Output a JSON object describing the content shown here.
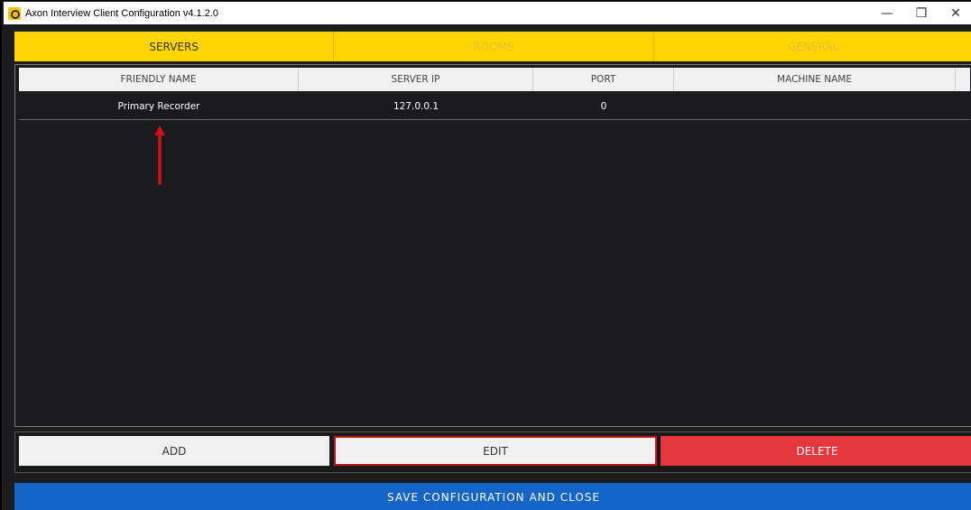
{
  "window": {
    "title": "Axon Interview Client Configuration v4.1.2.0",
    "controls": {
      "minimize": "—",
      "restore": "❐",
      "close": "✕"
    }
  },
  "tabs": [
    {
      "label": "SERVERS",
      "active": true
    },
    {
      "label": "ROOMS",
      "active": false
    },
    {
      "label": "GENERAL",
      "active": false
    }
  ],
  "grid": {
    "columns": [
      "FRIENDLY NAME",
      "SERVER IP",
      "PORT",
      "MACHINE NAME"
    ],
    "rows": [
      [
        "Primary Recorder",
        "127.0.0.1",
        "0",
        ""
      ]
    ]
  },
  "actions": {
    "add": "ADD",
    "edit": "EDIT",
    "delete": "DELETE"
  },
  "footer": {
    "save": "SAVE CONFIGURATION AND CLOSE"
  },
  "colors": {
    "tab_bar": "#ffd500",
    "delete": "#e5373d",
    "save": "#1565c8",
    "annotation_arrow": "#d0101a"
  }
}
